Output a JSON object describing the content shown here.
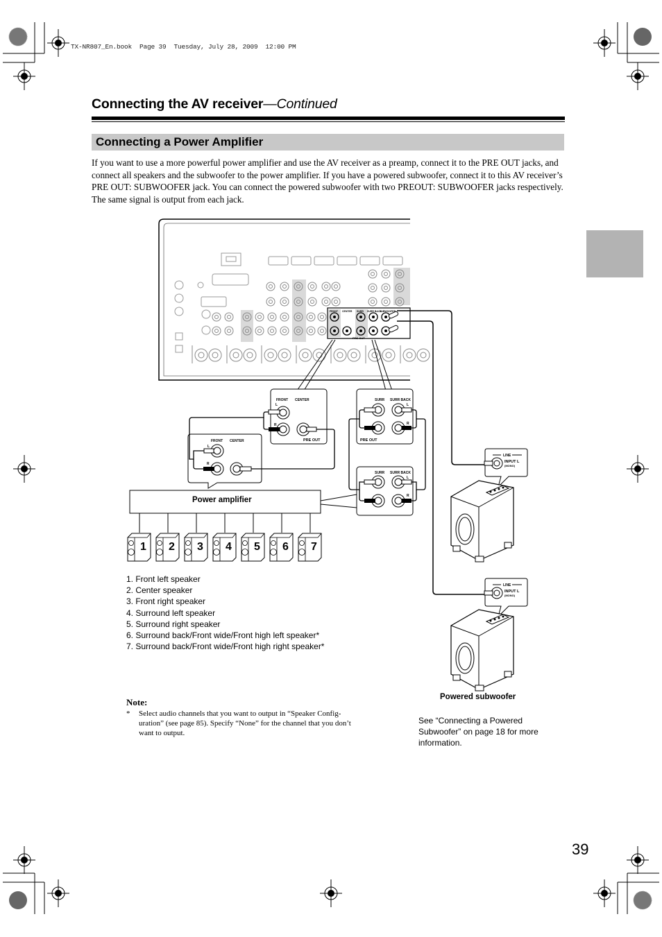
{
  "book_header": "TX-NR807_En.book  Page 39  Tuesday, July 28, 2009  12:00 PM",
  "page_title": {
    "main": "Connecting the AV receiver",
    "continued": "—Continued"
  },
  "section": {
    "title": "Connecting a Power Amplifier",
    "intro": "If you want to use a more powerful power amplifier and use the AV receiver as a preamp, connect it to the PRE OUT jacks, and connect all speakers and the subwoofer to the power amplifier. If you have a powered subwoofer, connect it to this AV receiver’s PRE OUT: SUBWOOFER jack. You can connect the powered subwoofer with two PREOUT: SUBWOOFER jacks respectively. The same signal is output from each jack."
  },
  "diagram": {
    "receiver_preout_labels": [
      "FRONT",
      "CENTER",
      "SURR",
      "SURR BACK",
      "SUBWOOFER"
    ],
    "preout_label": "PRE OUT",
    "callout_front": {
      "front": "FRONT",
      "center": "CENTER",
      "l": "L",
      "r": "R",
      "preout": "PRE OUT"
    },
    "callout_surr": {
      "surr": "SURR",
      "surr_back": "SURR BACK",
      "l": "L",
      "r": "R",
      "preout": "PRE OUT"
    },
    "amp_front": {
      "front": "FRONT",
      "center": "CENTER",
      "l": "L",
      "r": "R"
    },
    "amp_surr": {
      "surr": "SURR",
      "surr_back": "SURR BACK",
      "l": "L",
      "r": "R"
    },
    "power_amplifier_label": "Power amplifier",
    "sub_input": {
      "line": "LINE",
      "input": "INPUT  L",
      "mono": "(MONO)"
    },
    "speaker_numbers": [
      "1",
      "2",
      "3",
      "4",
      "5",
      "6",
      "7"
    ],
    "powered_subwoofer_label": "Powered subwoofer",
    "subwoofer_see": "See “Connecting a Powered Subwoofer” on page 18 for more information."
  },
  "speaker_legend": [
    "1. Front left speaker",
    "2. Center speaker",
    "3. Front right speaker",
    "4. Surround left speaker",
    "5. Surround right speaker",
    "6. Surround back/Front wide/Front high left speaker*",
    "7. Surround back/Front wide/Front high right speaker*"
  ],
  "note": {
    "heading": "Note:",
    "marker": "*",
    "text": "Select audio channels that you want to output in “Speaker Config-uration” (see page 85). Specify “None” for the channel that you don’t want to output."
  },
  "page_number": "39",
  "colors": {
    "section_bar": "#c8c8c8",
    "side_tab": "#b3b3b3",
    "panel_gray": "#d9d9d9"
  }
}
